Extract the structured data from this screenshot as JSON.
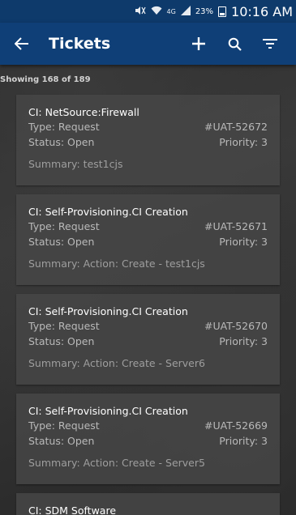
{
  "status_bar": {
    "battery": "23%",
    "time": "10:16 AM",
    "network": "4G"
  },
  "app_bar": {
    "title": "Tickets"
  },
  "list": {
    "count_text": "Showing 168 of 189",
    "tickets": [
      {
        "ci": "CI: NetSource:Firewall",
        "type": "Type: Request",
        "id": "#UAT-52672",
        "status": "Status: Open",
        "priority": "Priority: 3",
        "summary": "Summary: test1cjs"
      },
      {
        "ci": "CI: Self-Provisioning.CI Creation",
        "type": "Type: Request",
        "id": "#UAT-52671",
        "status": "Status: Open",
        "priority": "Priority: 3",
        "summary": "Summary: Action: Create - test1cjs"
      },
      {
        "ci": "CI: Self-Provisioning.CI Creation",
        "type": "Type: Request",
        "id": "#UAT-52670",
        "status": "Status: Open",
        "priority": "Priority: 3",
        "summary": "Summary: Action: Create - Server6"
      },
      {
        "ci": "CI: Self-Provisioning.CI Creation",
        "type": "Type: Request",
        "id": "#UAT-52669",
        "status": "Status: Open",
        "priority": "Priority: 3",
        "summary": "Summary: Action: Create - Server5"
      },
      {
        "ci": "CI: SDM Software"
      }
    ]
  }
}
